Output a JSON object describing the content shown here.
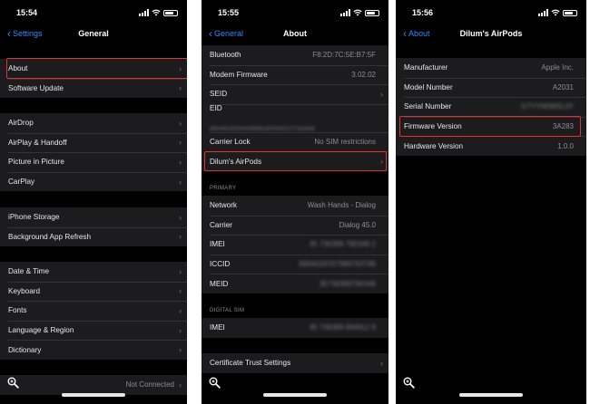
{
  "phones": [
    {
      "time": "15:54",
      "back": "Settings",
      "title": "General",
      "groups": [
        [
          "About"
        ],
        [
          "Software Update"
        ],
        [
          "AirDrop",
          "AirPlay & Handoff",
          "Picture in Picture",
          "CarPlay"
        ],
        [
          "iPhone Storage",
          "Background App Refresh"
        ],
        [
          "Date & Time",
          "Keyboard",
          "Fonts",
          "Language & Region",
          "Dictionary"
        ]
      ],
      "footer_value": "Not Connected"
    },
    {
      "time": "15:55",
      "back": "General",
      "title": "About",
      "rows": [
        {
          "label": "Bluetooth",
          "value": "F8:2D:7C:5E:B7:5F"
        },
        {
          "label": "Modem Firmware",
          "value": "3.02.02"
        },
        {
          "label": "SEID"
        },
        {
          "label": "EID",
          "value": "89049032004008882600045127282648"
        },
        {
          "label": "Carrier Lock",
          "value": "No SIM restrictions"
        }
      ],
      "airpods": "Dilum's AirPods",
      "primary_header": "PRIMARY",
      "primary_rows": [
        {
          "label": "Network",
          "value": "Wash Hands - Dialog"
        },
        {
          "label": "Carrier",
          "value": "Dialog 45.0"
        },
        {
          "label": "IMEI",
          "value": "35 736389 790349 2"
        },
        {
          "label": "ICCID",
          "value": "8994029707989763789"
        },
        {
          "label": "MEID",
          "value": "35736389790349"
        }
      ],
      "digital_header": "DIGITAL SIM",
      "digital_rows": [
        {
          "label": "IMEI",
          "value": "35 736389 694912 9"
        }
      ],
      "cert": "Certificate Trust Settings"
    },
    {
      "time": "15:56",
      "back": "About",
      "title": "Dilum's AirPods",
      "rows": [
        {
          "label": "Manufacturer",
          "value": "Apple Inc."
        },
        {
          "label": "Model Number",
          "value": "A2031"
        },
        {
          "label": "Serial Number",
          "value": "GTYYN0MSL0Y"
        },
        {
          "label": "Firmware Version",
          "value": "3A283"
        },
        {
          "label": "Hardware Version",
          "value": "1.0.0"
        }
      ]
    }
  ],
  "colors": {
    "accent": "#3a86ff",
    "highlight": "#e0322e",
    "cell": "#1c1c1e",
    "background": "#000000"
  }
}
